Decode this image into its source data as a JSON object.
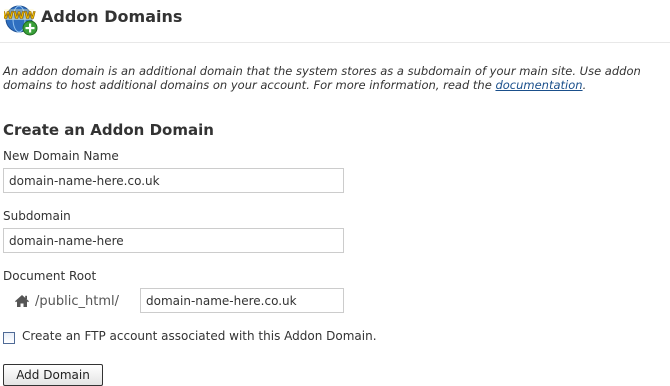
{
  "header": {
    "title": "Addon Domains",
    "logo_text": "WWW",
    "logo_icon": "www-globe-add-icon"
  },
  "description": {
    "line1": "An addon domain is an additional domain that the system stores as a subdomain of your main site. Use addon",
    "line2_prefix": "domains to host additional domains on your account. For more information, read the ",
    "link_text": "documentation",
    "line2_suffix": "."
  },
  "form": {
    "section_title": "Create an Addon Domain",
    "new_domain": {
      "label": "New Domain Name",
      "value": "domain-name-here.co.uk"
    },
    "subdomain": {
      "label": "Subdomain",
      "value": "domain-name-here"
    },
    "document_root": {
      "label": "Document Root",
      "prefix": "/public_html/",
      "prefix_icon": "home-icon",
      "value": "domain-name-here.co.uk"
    },
    "ftp_checkbox": {
      "label": "Create an FTP account associated with this Addon Domain.",
      "checked": false
    },
    "submit_label": "Add Domain"
  },
  "colors": {
    "link": "#1a4f8b",
    "text": "#333333",
    "input_border": "#cccccc",
    "logo_globe": "#2f6fc0",
    "logo_plus": "#3aa03a",
    "logo_text": "#f2c200"
  }
}
